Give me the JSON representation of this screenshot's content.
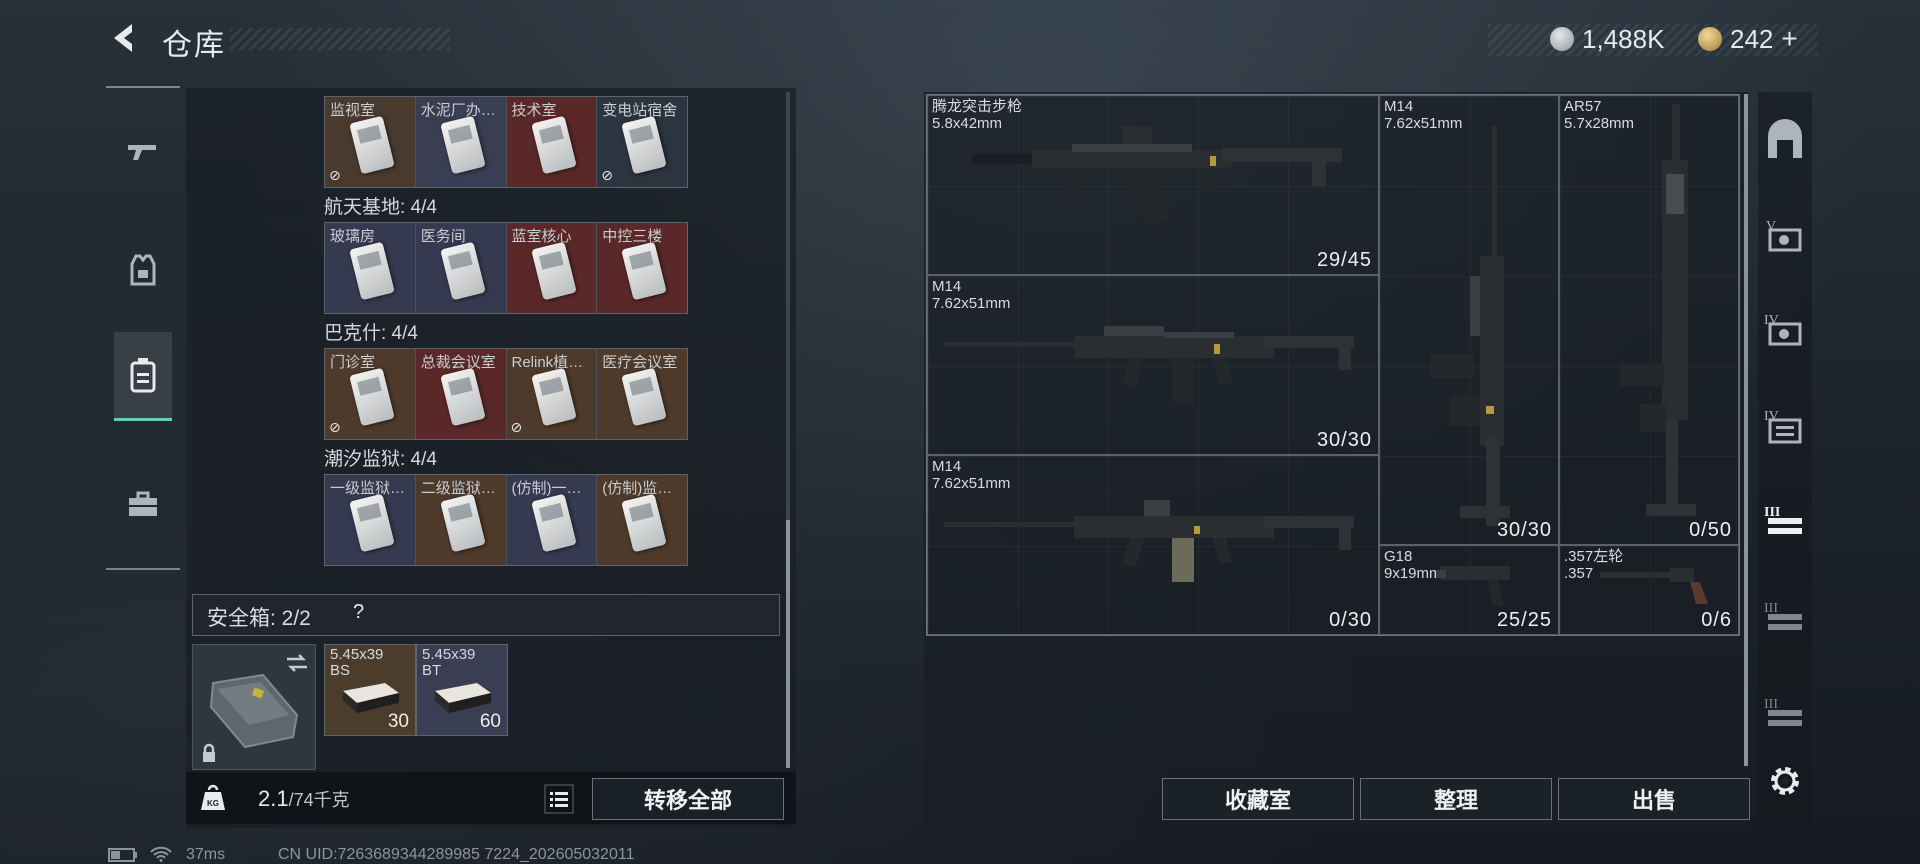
{
  "header": {
    "title": "仓库",
    "back_icon": "back-arrow-icon"
  },
  "currency": {
    "coins": "1,488K",
    "tokens": "242",
    "add": "+"
  },
  "categories": [
    {
      "icon": "rifle-icon"
    },
    {
      "icon": "vest-icon"
    },
    {
      "icon": "backpack-icon",
      "active": true
    },
    {
      "icon": "toolbox-icon"
    }
  ],
  "keycards": {
    "groups": [
      {
        "label": "",
        "cells": [
          "监视室",
          "水泥厂办…",
          "技术室",
          "变电站宿舍"
        ],
        "colors": [
          "#4a3a2e",
          "#3a3e52",
          "#5a2828",
          "#2c3440"
        ],
        "noswap": [
          true,
          false,
          false,
          true
        ]
      },
      {
        "label": "航天基地: 4/4",
        "cells": [
          "玻璃房",
          "医务间",
          "蓝室核心",
          "中控三楼"
        ],
        "colors": [
          "#353a50",
          "#353a50",
          "#5a2828",
          "#5a2828"
        ],
        "noswap": [
          false,
          false,
          false,
          false
        ]
      },
      {
        "label": "巴克什: 4/4",
        "cells": [
          "门诊室",
          "总裁会议室",
          "Relink植…",
          "医疗会议室"
        ],
        "colors": [
          "#4e3a2a",
          "#5a2828",
          "#4e3a2a",
          "#4e3a2a"
        ],
        "noswap": [
          true,
          false,
          true,
          false
        ]
      },
      {
        "label": "潮汐监狱: 4/4",
        "cells": [
          "一级监狱…",
          "二级监狱…",
          "(仿制)一…",
          "(仿制)监…"
        ],
        "colors": [
          "#353a50",
          "#4e3a2a",
          "#353a50",
          "#4e3a2a"
        ],
        "noswap": [
          false,
          false,
          false,
          false
        ]
      }
    ]
  },
  "safebox": {
    "label": "安全箱: 2/2",
    "help": "?"
  },
  "case_items": [
    {
      "name": "5.45x39\nBS",
      "count": "30"
    },
    {
      "name": "5.45x39\nBT",
      "count": "60"
    }
  ],
  "weight": {
    "current": "2.1",
    "max": "/74千克"
  },
  "buttons": {
    "transfer_all": "转移全部",
    "collection": "收藏室",
    "sort": "整理",
    "sell": "出售"
  },
  "status": {
    "ping": "37ms",
    "uid": "CN UID:7263689344289985 7224_202605032011"
  },
  "weapons": [
    {
      "name": "腾龙突击步枪",
      "caliber": "5.8x42mm",
      "ammo": "29/45"
    },
    {
      "name": "M14",
      "caliber": "7.62x51mm",
      "ammo": "30/30"
    },
    {
      "name": "M14",
      "caliber": "7.62x51mm",
      "ammo": "0/30"
    },
    {
      "name": "M14",
      "caliber": "7.62x51mm",
      "ammo": "30/30"
    },
    {
      "name": "AR57",
      "caliber": "5.7x28mm",
      "ammo": "0/50"
    },
    {
      "name": "G18",
      "caliber": "9x19mm",
      "ammo": "25/25"
    },
    {
      "name": ".357左轮",
      "caliber": ".357",
      "ammo": "0/6"
    }
  ],
  "side_tabs": [
    "base-icon",
    "vault-v-icon",
    "vault-iv-icon",
    "shelf-iv-icon",
    "rack-iii-icon",
    "rack-iii-icon",
    "rack-iii-icon",
    "settings-icon"
  ]
}
